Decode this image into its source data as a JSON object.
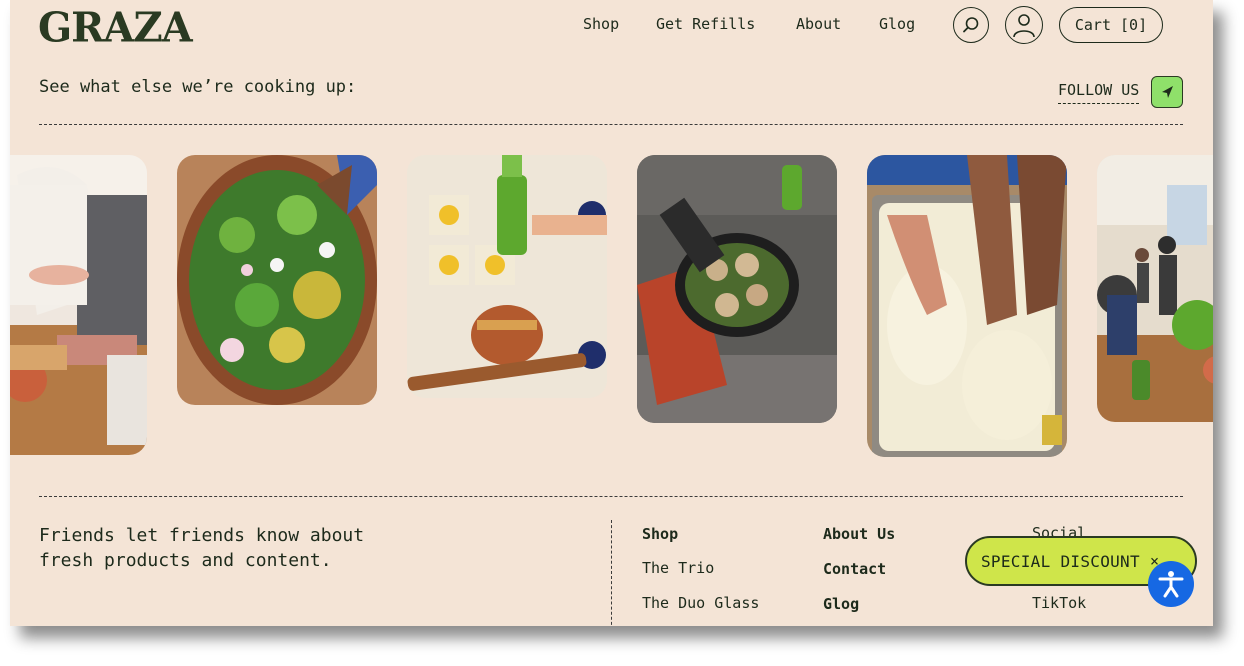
{
  "header": {
    "logo": "GRAZA",
    "nav": [
      "Shop",
      "Get Refills",
      "About",
      "Glog"
    ],
    "cart_label": "Cart [0]",
    "search_icon": "search-icon",
    "account_icon": "user-icon"
  },
  "feed": {
    "heading": "See what else we’re cooking up:",
    "follow_label": "FOLLOW US",
    "follow_icon": "arrow-icon",
    "images": [
      "Person slicing bread on cutting board",
      "Green salad in wooden bowl",
      "Graza bottle drizzling oil on sandwich",
      "Cast iron skillet on grill",
      "Hands pressing focaccia dough",
      "Friends eating at table"
    ]
  },
  "footer": {
    "tagline": "Friends let friends know about fresh products and content.",
    "col1": [
      "Shop",
      "The Trio",
      "The Duo Glass"
    ],
    "col2": [
      "About Us",
      "Contact",
      "Glog"
    ],
    "col3": [
      "Social",
      "TikTok"
    ]
  },
  "promo": {
    "label": "SPECIAL DISCOUNT",
    "close": "×"
  },
  "colors": {
    "background": "#f4e4d6",
    "accent_green": "#8fe06a",
    "promo_yellow": "#cfe54a",
    "accessibility_blue": "#1668e3",
    "text": "#1d2a1b"
  }
}
